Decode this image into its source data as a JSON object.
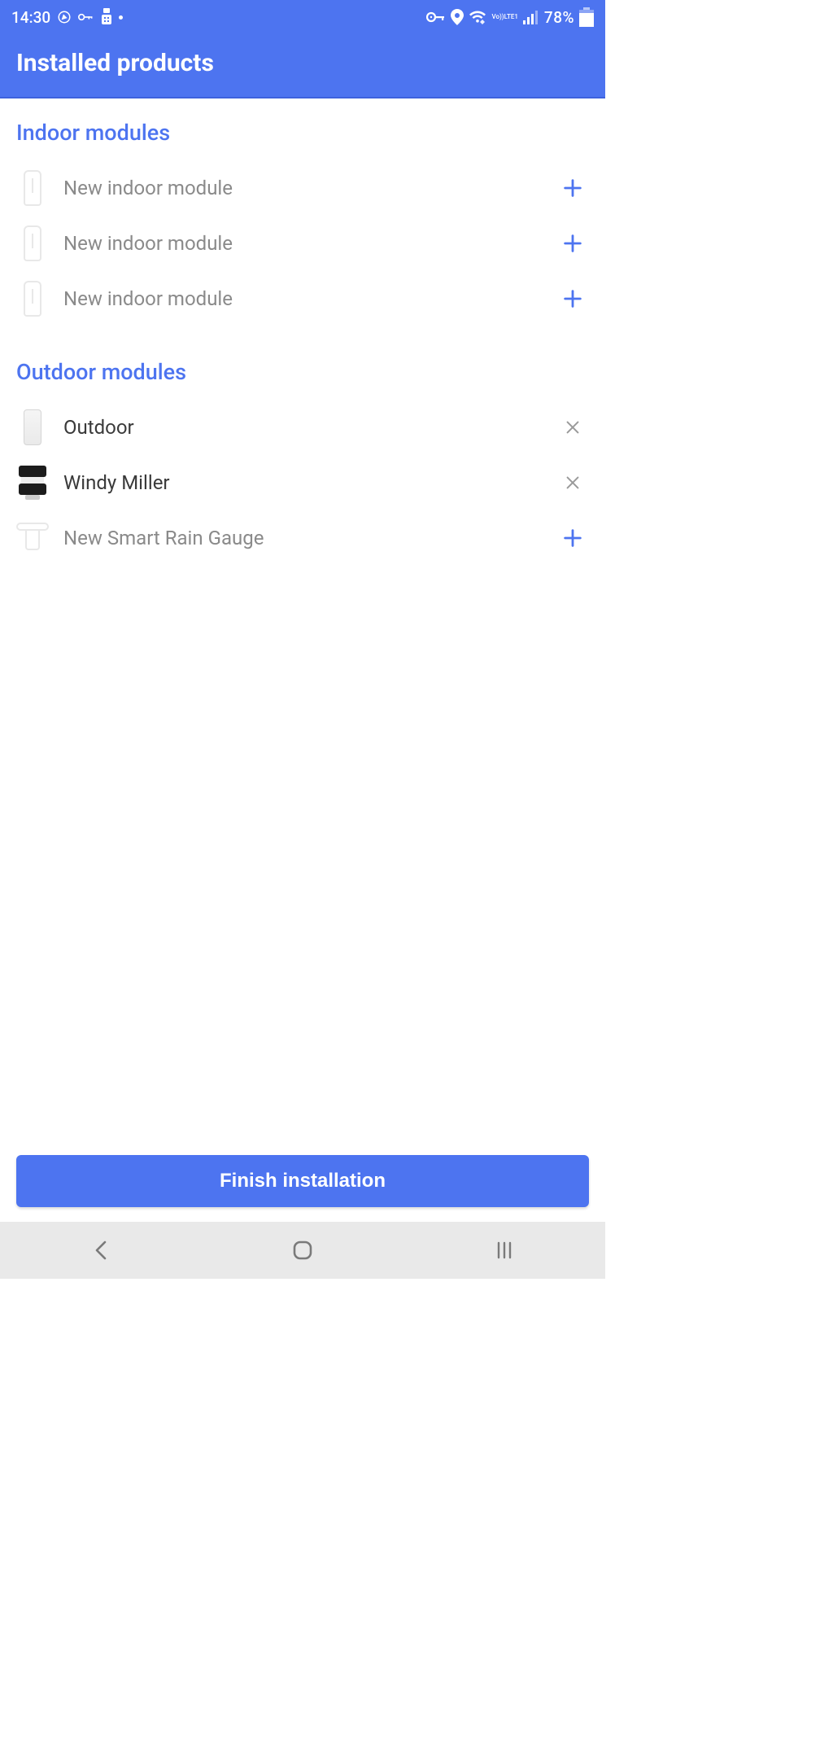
{
  "status": {
    "time": "14:30",
    "battery_percent": "78%",
    "lte_label": "LTE1",
    "vo_label": "Vo))"
  },
  "header": {
    "title": "Installed products"
  },
  "indoor": {
    "section_title": "Indoor modules",
    "rows": [
      {
        "label": "New indoor module",
        "action": "add"
      },
      {
        "label": "New indoor module",
        "action": "add"
      },
      {
        "label": "New indoor module",
        "action": "add"
      }
    ]
  },
  "outdoor": {
    "section_title": "Outdoor modules",
    "rows": [
      {
        "label": "Outdoor",
        "action": "remove",
        "dark": true
      },
      {
        "label": "Windy Miller",
        "action": "remove",
        "dark": true
      },
      {
        "label": "New Smart Rain Gauge",
        "action": "add",
        "dark": false
      }
    ]
  },
  "finish_button": "Finish installation"
}
